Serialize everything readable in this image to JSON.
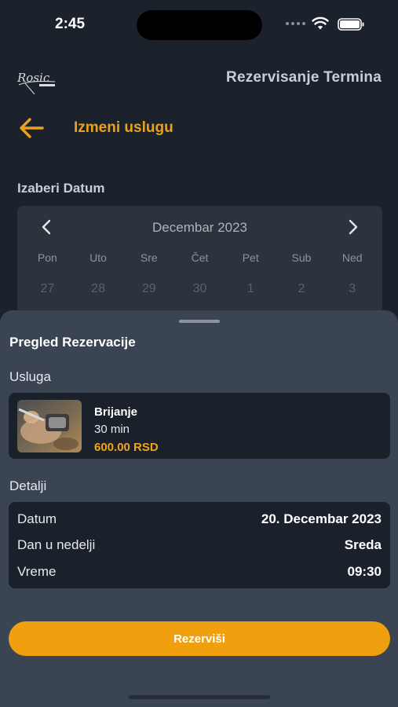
{
  "status_bar": {
    "time": "2:45"
  },
  "header": {
    "logo_text": "Rosic",
    "title": "Rezervisanje Termina",
    "back_label": "Izmeni uslugu"
  },
  "date_section": {
    "label": "Izaberi Datum"
  },
  "calendar": {
    "month": "Decembar 2023",
    "weekdays": [
      "Pon",
      "Uto",
      "Sre",
      "Čet",
      "Pet",
      "Sub",
      "Ned"
    ],
    "days": [
      "27",
      "28",
      "29",
      "30",
      "1",
      "2",
      "3"
    ]
  },
  "sheet": {
    "title": "Pregled Rezervacije",
    "service_label": "Usluga",
    "service": {
      "name": "Brijanje",
      "duration": "30 min",
      "price": "600.00 RSD"
    },
    "details_label": "Detalji",
    "details": [
      {
        "key": "Datum",
        "value": "20. Decembar 2023"
      },
      {
        "key": "Dan u nedelji",
        "value": "Sreda"
      },
      {
        "key": "Vreme",
        "value": "09:30"
      }
    ],
    "reserve_label": "Rezerviši"
  },
  "colors": {
    "accent": "#f0a00f",
    "background": "#1c222c",
    "sheet": "#3a4453",
    "card": "#1b212b"
  }
}
